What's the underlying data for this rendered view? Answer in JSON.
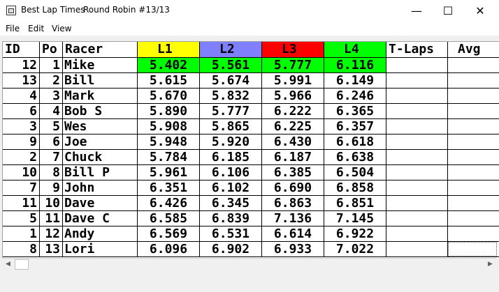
{
  "window": {
    "app_title": "Best Lap Times",
    "subtitle": "Round Robin #13/13",
    "minimize_glyph": "—",
    "maximize_glyph": "☐",
    "close_glyph": "✕"
  },
  "menu": {
    "items": [
      "File",
      "Edit",
      "View"
    ]
  },
  "table": {
    "headers": [
      "ID",
      "Po",
      "Racer",
      "L1",
      "L2",
      "L3",
      "L4",
      "T-Laps",
      "Avg"
    ],
    "header_colors": {
      "L1": "#ffff00",
      "L2": "#8080ff",
      "L3": "#ff0000",
      "L4": "#00ff00"
    },
    "best_highlight_color": "#00ff00",
    "rows": [
      {
        "id": "12",
        "pos": "1",
        "racer": "Mike",
        "l1": "5.402",
        "l2": "5.561",
        "l3": "5.777",
        "l4": "6.116",
        "tlaps": "",
        "avg": ""
      },
      {
        "id": "13",
        "pos": "2",
        "racer": "Bill",
        "l1": "5.615",
        "l2": "5.674",
        "l3": "5.991",
        "l4": "6.149",
        "tlaps": "",
        "avg": ""
      },
      {
        "id": "4",
        "pos": "3",
        "racer": "Mark",
        "l1": "5.670",
        "l2": "5.832",
        "l3": "5.966",
        "l4": "6.246",
        "tlaps": "",
        "avg": ""
      },
      {
        "id": "6",
        "pos": "4",
        "racer": "Bob S",
        "l1": "5.890",
        "l2": "5.777",
        "l3": "6.222",
        "l4": "6.365",
        "tlaps": "",
        "avg": ""
      },
      {
        "id": "3",
        "pos": "5",
        "racer": "Wes",
        "l1": "5.908",
        "l2": "5.865",
        "l3": "6.225",
        "l4": "6.357",
        "tlaps": "",
        "avg": ""
      },
      {
        "id": "9",
        "pos": "6",
        "racer": "Joe",
        "l1": "5.948",
        "l2": "5.920",
        "l3": "6.430",
        "l4": "6.618",
        "tlaps": "",
        "avg": ""
      },
      {
        "id": "2",
        "pos": "7",
        "racer": "Chuck",
        "l1": "5.784",
        "l2": "6.185",
        "l3": "6.187",
        "l4": "6.638",
        "tlaps": "",
        "avg": ""
      },
      {
        "id": "10",
        "pos": "8",
        "racer": "Bill P",
        "l1": "5.961",
        "l2": "6.106",
        "l3": "6.385",
        "l4": "6.504",
        "tlaps": "",
        "avg": ""
      },
      {
        "id": "7",
        "pos": "9",
        "racer": "John",
        "l1": "6.351",
        "l2": "6.102",
        "l3": "6.690",
        "l4": "6.858",
        "tlaps": "",
        "avg": ""
      },
      {
        "id": "11",
        "pos": "10",
        "racer": "Dave",
        "l1": "6.426",
        "l2": "6.345",
        "l3": "6.863",
        "l4": "6.851",
        "tlaps": "",
        "avg": ""
      },
      {
        "id": "5",
        "pos": "11",
        "racer": "Dave C",
        "l1": "6.585",
        "l2": "6.839",
        "l3": "7.136",
        "l4": "7.145",
        "tlaps": "",
        "avg": ""
      },
      {
        "id": "1",
        "pos": "12",
        "racer": "Andy",
        "l1": "6.569",
        "l2": "6.531",
        "l3": "6.614",
        "l4": "6.922",
        "tlaps": "",
        "avg": ""
      },
      {
        "id": "8",
        "pos": "13",
        "racer": "Lori",
        "l1": "6.096",
        "l2": "6.902",
        "l3": "6.933",
        "l4": "7.022",
        "tlaps": "",
        "avg": ""
      }
    ],
    "highlighted_row": 0,
    "focused_cell": {
      "row": 12,
      "col": "avg"
    }
  },
  "scrollbar": {
    "left_glyph": "◀",
    "right_glyph": "▶"
  }
}
